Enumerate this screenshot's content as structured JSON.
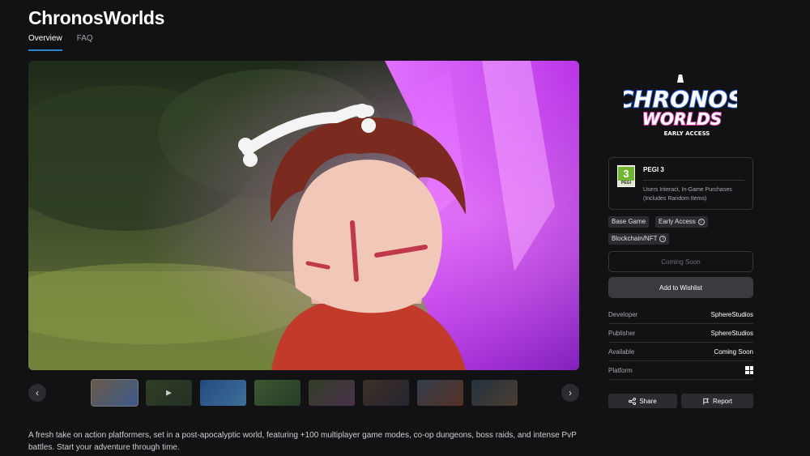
{
  "page": {
    "title": "ChronosWorlds"
  },
  "tabs": [
    {
      "label": "Overview",
      "active": true
    },
    {
      "label": "FAQ",
      "active": false
    }
  ],
  "carousel": {
    "prev_icon": "chevron-left-icon",
    "next_icon": "chevron-right-icon",
    "prev_glyph": "‹",
    "next_glyph": "›",
    "thumbnail_count": 8,
    "active_index": 0,
    "video_thumbnail_index": 1
  },
  "description": "A fresh take on action platformers, set in a post-apocalyptic world, featuring +100 multiplayer game modes, co-op dungeons, boss raids, and intense PvP battles. Start your adventure through time.",
  "logo": {
    "line1": "CHRONOS",
    "line2": "WORLDS",
    "line3": "EARLY ACCESS"
  },
  "rating": {
    "badge_number": "3",
    "badge_label": "PEGI",
    "title": "PEGI 3",
    "descriptor": "Users Interact, In-Game Purchases (Includes Random Items)"
  },
  "tags": [
    {
      "label": "Base Game",
      "has_info": false
    },
    {
      "label": "Early Access",
      "has_info": true
    },
    {
      "label": "Blockchain/NFT",
      "has_info": true
    }
  ],
  "buttons": {
    "coming_soon": "Coming Soon",
    "wishlist": "Add to Wishlist",
    "share": "Share",
    "report": "Report"
  },
  "details": [
    {
      "key": "Developer",
      "value": "SphereStudios"
    },
    {
      "key": "Publisher",
      "value": "SphereStudios"
    },
    {
      "key": "Available",
      "value": "Coming Soon"
    },
    {
      "key": "Platform",
      "value": "",
      "icon": "windows-icon"
    }
  ],
  "colors": {
    "accent": "#2a86c8",
    "background": "#121215",
    "crystal": "#c43cf0"
  }
}
